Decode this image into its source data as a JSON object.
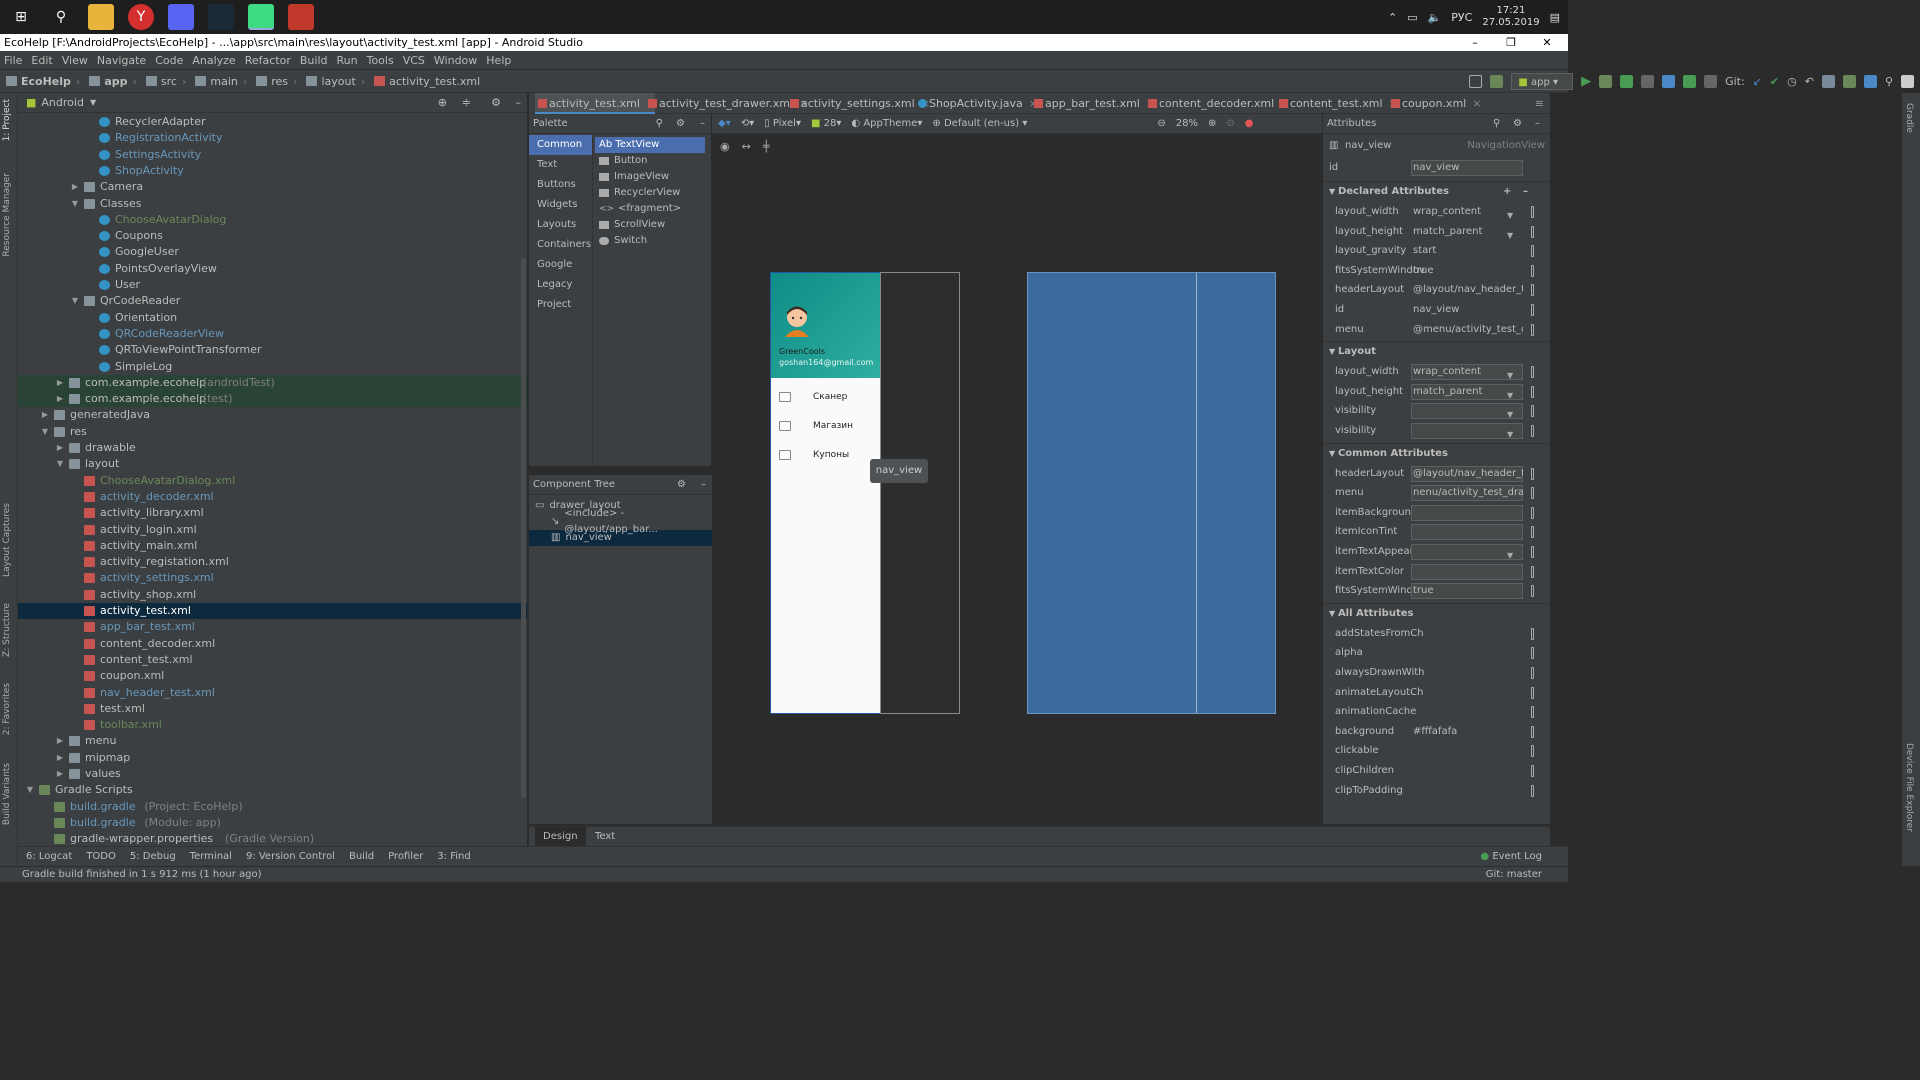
{
  "taskbar": {
    "time": "17:21",
    "date": "27.05.2019",
    "lang": "РУС"
  },
  "title": "EcoHelp [F:\\AndroidProjects\\EcoHelp] - ...\\app\\src\\main\\res\\layout\\activity_test.xml [app] - Android Studio",
  "menu": [
    "File",
    "Edit",
    "View",
    "Navigate",
    "Code",
    "Analyze",
    "Refactor",
    "Build",
    "Run",
    "Tools",
    "VCS",
    "Window",
    "Help"
  ],
  "breadcrumb": [
    "EcoHelp",
    "app",
    "src",
    "main",
    "res",
    "layout",
    "activity_test.xml"
  ],
  "run_config": "app",
  "git_label": "Git:",
  "project_view": "Android",
  "tree": [
    {
      "label": "RecyclerAdapter",
      "kind": "cls",
      "depth": 5,
      "color": "#bbbbbb"
    },
    {
      "label": "RegistrationActivity",
      "kind": "cls",
      "depth": 5,
      "color": "#6897bb"
    },
    {
      "label": "SettingsActivity",
      "kind": "cls",
      "depth": 5,
      "color": "#6897bb"
    },
    {
      "label": "ShopActivity",
      "kind": "cls",
      "depth": 5,
      "color": "#6897bb"
    },
    {
      "label": "Camera",
      "kind": "fold",
      "depth": 4,
      "arrow": "▶",
      "color": "#bbbbbb"
    },
    {
      "label": "Classes",
      "kind": "fold",
      "depth": 4,
      "arrow": "▼",
      "color": "#bbbbbb"
    },
    {
      "label": "ChooseAvatarDialog",
      "kind": "cls",
      "depth": 5,
      "color": "#6a8759"
    },
    {
      "label": "Coupons",
      "kind": "cls",
      "depth": 5,
      "color": "#bbbbbb"
    },
    {
      "label": "GoogleUser",
      "kind": "cls",
      "depth": 5,
      "color": "#bbbbbb"
    },
    {
      "label": "PointsOverlayView",
      "kind": "cls",
      "depth": 5,
      "color": "#bbbbbb"
    },
    {
      "label": "User",
      "kind": "cls",
      "depth": 5,
      "color": "#bbbbbb"
    },
    {
      "label": "QrCodeReader",
      "kind": "fold",
      "depth": 4,
      "arrow": "▼",
      "color": "#bbbbbb"
    },
    {
      "label": "Orientation",
      "kind": "cls",
      "depth": 5,
      "color": "#bbbbbb"
    },
    {
      "label": "QRCodeReaderView",
      "kind": "cls",
      "depth": 5,
      "color": "#6897bb"
    },
    {
      "label": "QRToViewPointTransformer",
      "kind": "cls",
      "depth": 5,
      "color": "#bbbbbb"
    },
    {
      "label": "SimpleLog",
      "kind": "cls",
      "depth": 5,
      "color": "#bbbbbb"
    },
    {
      "label": "com.example.ecohelp",
      "suffix": " (androidTest)",
      "kind": "fold",
      "depth": 3,
      "arrow": "▶",
      "color": "#bbbbbb",
      "row": "gtest"
    },
    {
      "label": "com.example.ecohelp",
      "suffix": " (test)",
      "kind": "fold",
      "depth": 3,
      "arrow": "▶",
      "color": "#bbbbbb",
      "row": "gtest"
    },
    {
      "label": "generatedJava",
      "kind": "fold",
      "depth": 2,
      "arrow": "▶",
      "color": "#bbbbbb"
    },
    {
      "label": "res",
      "kind": "fold",
      "depth": 2,
      "arrow": "▼",
      "color": "#bbbbbb"
    },
    {
      "label": "drawable",
      "kind": "fold",
      "depth": 3,
      "arrow": "▶",
      "color": "#bbbbbb"
    },
    {
      "label": "layout",
      "kind": "fold",
      "depth": 3,
      "arrow": "▼",
      "color": "#bbbbbb"
    },
    {
      "label": "ChooseAvatarDialog.xml",
      "kind": "xml",
      "depth": 4,
      "color": "#6a8759"
    },
    {
      "label": "activity_decoder.xml",
      "kind": "xml",
      "depth": 4,
      "color": "#6897bb"
    },
    {
      "label": "activity_library.xml",
      "kind": "xml",
      "depth": 4,
      "color": "#bbbbbb"
    },
    {
      "label": "activity_login.xml",
      "kind": "xml",
      "depth": 4,
      "color": "#bbbbbb"
    },
    {
      "label": "activity_main.xml",
      "kind": "xml",
      "depth": 4,
      "color": "#bbbbbb"
    },
    {
      "label": "activity_registation.xml",
      "kind": "xml",
      "depth": 4,
      "color": "#bbbbbb"
    },
    {
      "label": "activity_settings.xml",
      "kind": "xml",
      "depth": 4,
      "color": "#6897bb"
    },
    {
      "label": "activity_shop.xml",
      "kind": "xml",
      "depth": 4,
      "color": "#bbbbbb"
    },
    {
      "label": "activity_test.xml",
      "kind": "xml",
      "depth": 4,
      "color": "#ffffff",
      "row": "sel"
    },
    {
      "label": "app_bar_test.xml",
      "kind": "xml",
      "depth": 4,
      "color": "#6897bb"
    },
    {
      "label": "content_decoder.xml",
      "kind": "xml",
      "depth": 4,
      "color": "#bbbbbb"
    },
    {
      "label": "content_test.xml",
      "kind": "xml",
      "depth": 4,
      "color": "#bbbbbb"
    },
    {
      "label": "coupon.xml",
      "kind": "xml",
      "depth": 4,
      "color": "#bbbbbb"
    },
    {
      "label": "nav_header_test.xml",
      "kind": "xml",
      "depth": 4,
      "color": "#6897bb"
    },
    {
      "label": "test.xml",
      "kind": "xml",
      "depth": 4,
      "color": "#bbbbbb"
    },
    {
      "label": "toolbar.xml",
      "kind": "xml",
      "depth": 4,
      "color": "#6a8759"
    },
    {
      "label": "menu",
      "kind": "fold",
      "depth": 3,
      "arrow": "▶",
      "color": "#bbbbbb"
    },
    {
      "label": "mipmap",
      "kind": "fold",
      "depth": 3,
      "arrow": "▶",
      "color": "#bbbbbb"
    },
    {
      "label": "values",
      "kind": "fold",
      "depth": 3,
      "arrow": "▶",
      "color": "#bbbbbb"
    },
    {
      "label": "Gradle Scripts",
      "kind": "gr",
      "depth": 1,
      "arrow": "▼",
      "color": "#bbbbbb"
    },
    {
      "label": "build.gradle",
      "suffix": " (Project: EcoHelp)",
      "kind": "gr",
      "depth": 2,
      "color": "#6897bb"
    },
    {
      "label": "build.gradle",
      "suffix": " (Module: app)",
      "kind": "gr",
      "depth": 2,
      "color": "#6897bb"
    },
    {
      "label": "gradle-wrapper.properties",
      "suffix": " (Gradle Version)",
      "kind": "gr",
      "depth": 2,
      "color": "#bbbbbb"
    }
  ],
  "editor_tabs": [
    "activity_test.xml",
    "activity_test_drawer.xml",
    "activity_settings.xml",
    "ShopActivity.java",
    "app_bar_test.xml",
    "content_decoder.xml",
    "content_test.xml",
    "coupon.xml"
  ],
  "palette": {
    "title": "Palette",
    "categories": [
      "Common",
      "Text",
      "Buttons",
      "Widgets",
      "Layouts",
      "Containers",
      "Google",
      "Legacy",
      "Project"
    ],
    "items": [
      "Ab TextView",
      "Button",
      "ImageView",
      "RecyclerView",
      "<fragment>",
      "ScrollView",
      "Switch"
    ]
  },
  "component_tree": {
    "title": "Component Tree",
    "rows": [
      "drawer_layout",
      "<include> - @layout/app_bar...",
      "nav_view"
    ]
  },
  "design_toolbar": {
    "device": "Pixel",
    "api": "28",
    "theme": "AppTheme",
    "locale": "Default (en-us)",
    "zoom": "28%"
  },
  "phone": {
    "name": "GreenCools",
    "email": "goshan164@gmail.com",
    "menu_items": [
      "Сканер",
      "Магазин",
      "Купоны"
    ],
    "tooltip": "nav_view"
  },
  "attributes": {
    "title": "Attributes",
    "view_id": "nav_view",
    "view_type": "NavigationView",
    "id_value": "nav_view",
    "sections": [
      {
        "header": "Declared Attributes",
        "rows": [
          {
            "name": "layout_width",
            "value": "wrap_content",
            "dd": true
          },
          {
            "name": "layout_height",
            "value": "match_parent",
            "dd": true
          },
          {
            "name": "layout_gravity",
            "value": "start"
          },
          {
            "name": "fitsSystemWindov",
            "value": "true"
          },
          {
            "name": "headerLayout",
            "value": "@layout/nav_header_test"
          },
          {
            "name": "id",
            "value": "nav_view"
          },
          {
            "name": "menu",
            "value": "@menu/activity_test_drav"
          }
        ]
      },
      {
        "header": "Layout",
        "rows": [
          {
            "name": "layout_width",
            "value": "wrap_content",
            "dd": true,
            "box": true
          },
          {
            "name": "layout_height",
            "value": "match_parent",
            "dd": true,
            "box": true
          },
          {
            "name": "visibility",
            "value": "",
            "dd": true,
            "box": true
          },
          {
            "name": "visibility",
            "value": "",
            "dd": true,
            "box": true
          }
        ]
      },
      {
        "header": "Common Attributes",
        "rows": [
          {
            "name": "headerLayout",
            "value": "@layout/nav_header_test",
            "box": true
          },
          {
            "name": "menu",
            "value": "nenu/activity_test_drawer",
            "box": true
          },
          {
            "name": "itemBackground",
            "value": "",
            "box": true
          },
          {
            "name": "itemIconTint",
            "value": "",
            "box": true
          },
          {
            "name": "itemTextAppeara...",
            "value": "",
            "dd": true,
            "box": true
          },
          {
            "name": "itemTextColor",
            "value": "",
            "box": true
          },
          {
            "name": "fitsSystemWindows",
            "value": "true",
            "box": true
          }
        ]
      },
      {
        "header": "All Attributes",
        "rows": [
          {
            "name": "addStatesFromCh",
            "value": ""
          },
          {
            "name": "alpha",
            "value": ""
          },
          {
            "name": "alwaysDrawnWith",
            "value": ""
          },
          {
            "name": "animateLayoutCh",
            "value": ""
          },
          {
            "name": "animationCache",
            "value": ""
          },
          {
            "name": "background",
            "value": "#fffafafa"
          },
          {
            "name": "clickable",
            "value": ""
          },
          {
            "name": "clipChildren",
            "value": ""
          },
          {
            "name": "clipToPadding",
            "value": ""
          }
        ]
      }
    ]
  },
  "bottom_tabs": [
    "Design",
    "Text"
  ],
  "tool_windows": [
    "6: Logcat",
    "TODO",
    "5: Debug",
    "Terminal",
    "9: Version Control",
    "Build",
    "Profiler",
    "3: Find"
  ],
  "event_log": "Event Log",
  "status": "Gradle build finished in 1 s 912 ms (1 hour ago)",
  "git_branch": "Git: master",
  "left_strip": [
    "1: Project",
    "Resource Manager",
    "Layout Captures",
    "Z: Structure",
    "2: Favorites",
    "Build Variants"
  ],
  "right_strip": [
    "Gradle",
    "Device File Explorer"
  ],
  "colors": {
    "accent": "#4a88c7",
    "drawer_header": "#0e8c86",
    "blueprint": "#3b6a9e"
  }
}
